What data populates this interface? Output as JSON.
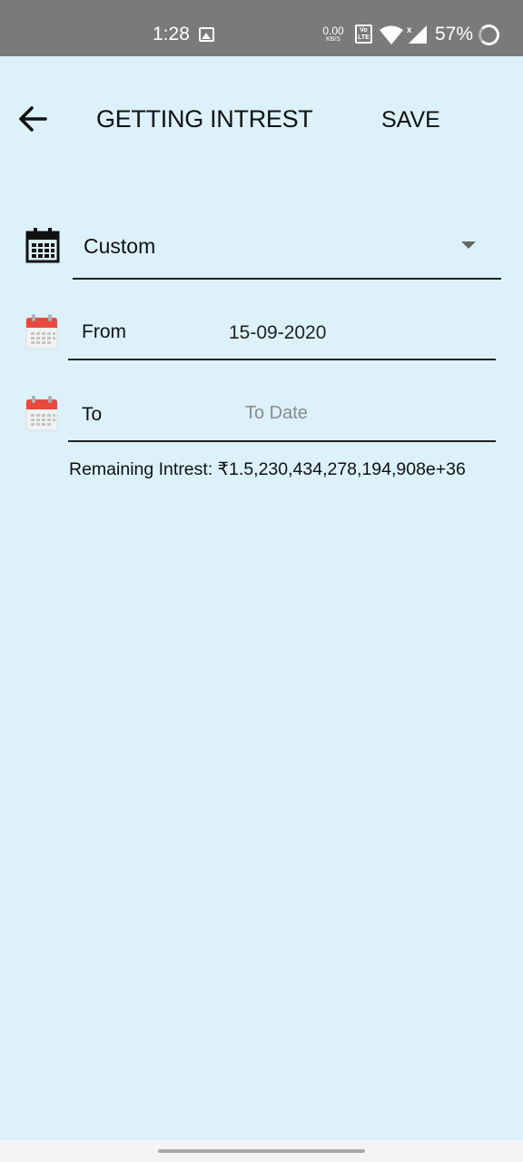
{
  "status_bar": {
    "time": "1:28",
    "net_speed_value": "0.00",
    "net_speed_unit": "KB/S",
    "volte_top": "Vo",
    "volte_bottom": "LTE",
    "battery_percent": "57%",
    "icons": [
      "gallery-icon",
      "wifi-icon",
      "signal-icon",
      "battery-ring-icon"
    ]
  },
  "header": {
    "title": "GETTING INTREST",
    "save_label": "SAVE"
  },
  "period": {
    "selected": "Custom"
  },
  "from": {
    "label": "From",
    "value": "15-09-2020"
  },
  "to": {
    "label": "To",
    "placeholder": "To Date"
  },
  "remaining": "Remaining Intrest: ₹1.5,230,434,278,194,908e+36",
  "colors": {
    "background": "#dcf1fa",
    "status_bar": "#7a7a7a",
    "calendar_red": "#e8493f",
    "underline": "#222222"
  }
}
